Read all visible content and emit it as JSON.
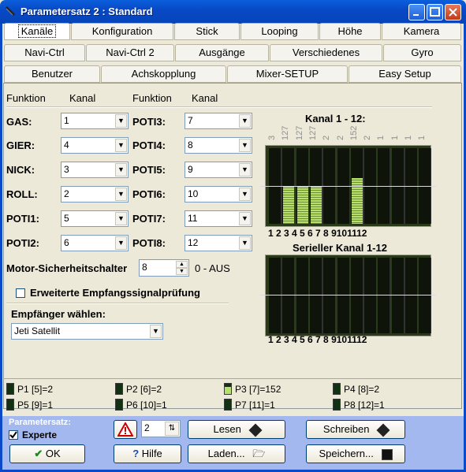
{
  "window": {
    "title": "Parametersatz 2 : Standard"
  },
  "tabs": {
    "row1": [
      "Kanäle",
      "Konfiguration",
      "Stick",
      "Looping",
      "Höhe",
      "Kamera"
    ],
    "row2": [
      "Navi-Ctrl",
      "Navi-Ctrl 2",
      "Ausgänge",
      "Verschiedenes",
      "Gyro"
    ],
    "row3": [
      "Benutzer",
      "Achskopplung",
      "Mixer-SETUP",
      "Easy Setup"
    ]
  },
  "headers": {
    "funktion1": "Funktion",
    "kanal1": "Kanal",
    "funktion2": "Funktion",
    "kanal2": "Kanal"
  },
  "left_fields": [
    {
      "label": "GAS:",
      "value": "1"
    },
    {
      "label": "GIER:",
      "value": "4"
    },
    {
      "label": "NICK:",
      "value": "3"
    },
    {
      "label": "ROLL:",
      "value": "2"
    },
    {
      "label": "POTI1:",
      "value": "5"
    },
    {
      "label": "POTI2:",
      "value": "6"
    }
  ],
  "right_fields": [
    {
      "label": "POTI3:",
      "value": "7"
    },
    {
      "label": "POTI4:",
      "value": "8"
    },
    {
      "label": "POTI5:",
      "value": "9"
    },
    {
      "label": "POTI6:",
      "value": "10"
    },
    {
      "label": "POTI7:",
      "value": "11"
    },
    {
      "label": "POTI8:",
      "value": "12"
    }
  ],
  "motor": {
    "label": "Motor-Sicherheitschalter",
    "value": "8",
    "hint": "0 - AUS"
  },
  "erweiterte": {
    "label": "Erweiterte Empfangssignalprüfung",
    "checked": false
  },
  "empfaenger": {
    "label": "Empfänger wählen:",
    "value": "Jeti Satellit"
  },
  "kanal_panel": {
    "title": "Kanal 1 - 12:",
    "values": [
      "3",
      "127",
      "127",
      "127",
      "2",
      "2",
      "152",
      "2",
      "1",
      "1",
      "1",
      "1"
    ],
    "levels": [
      0.0,
      0.5,
      0.5,
      0.5,
      0.0,
      0.0,
      0.6,
      0.0,
      0.0,
      0.0,
      0.0,
      0.0
    ],
    "numbers": "1 2 3 4 5 6 7 8 9101112"
  },
  "seriell_panel": {
    "title": "Serieller Kanal 1-12",
    "numbers": "1 2 3 4 5 6 7 8 9101112"
  },
  "pfields": [
    {
      "text": "P1 [5]=2",
      "level": 0.0
    },
    {
      "text": "P2 [6]=2",
      "level": 0.0
    },
    {
      "text": "P3 [7]=152",
      "level": 0.6
    },
    {
      "text": "P4 [8]=2",
      "level": 0.0
    },
    {
      "text": "P5 [9]=1",
      "level": 0.0
    },
    {
      "text": "P6 [10]=1",
      "level": 0.0
    },
    {
      "text": "P7 [11]=1",
      "level": 0.0
    },
    {
      "text": "P8 [12]=1",
      "level": 0.0
    }
  ],
  "bottom": {
    "param_label": "Parametersatz:",
    "experte_label": "Experte",
    "experte_checked": true,
    "spin_value": "2",
    "ok_label": "OK",
    "hilfe_label": "Hilfe",
    "lesen_label": "Lesen",
    "laden_label": "Laden...",
    "schreiben_label": "Schreiben",
    "speichern_label": "Speichern..."
  },
  "colors": {
    "titlebar": "#0a5fdc",
    "bottom_panel": "#a3b8ef",
    "meter_fill": "#b7e06b",
    "meter_bg": "#0e140a"
  }
}
